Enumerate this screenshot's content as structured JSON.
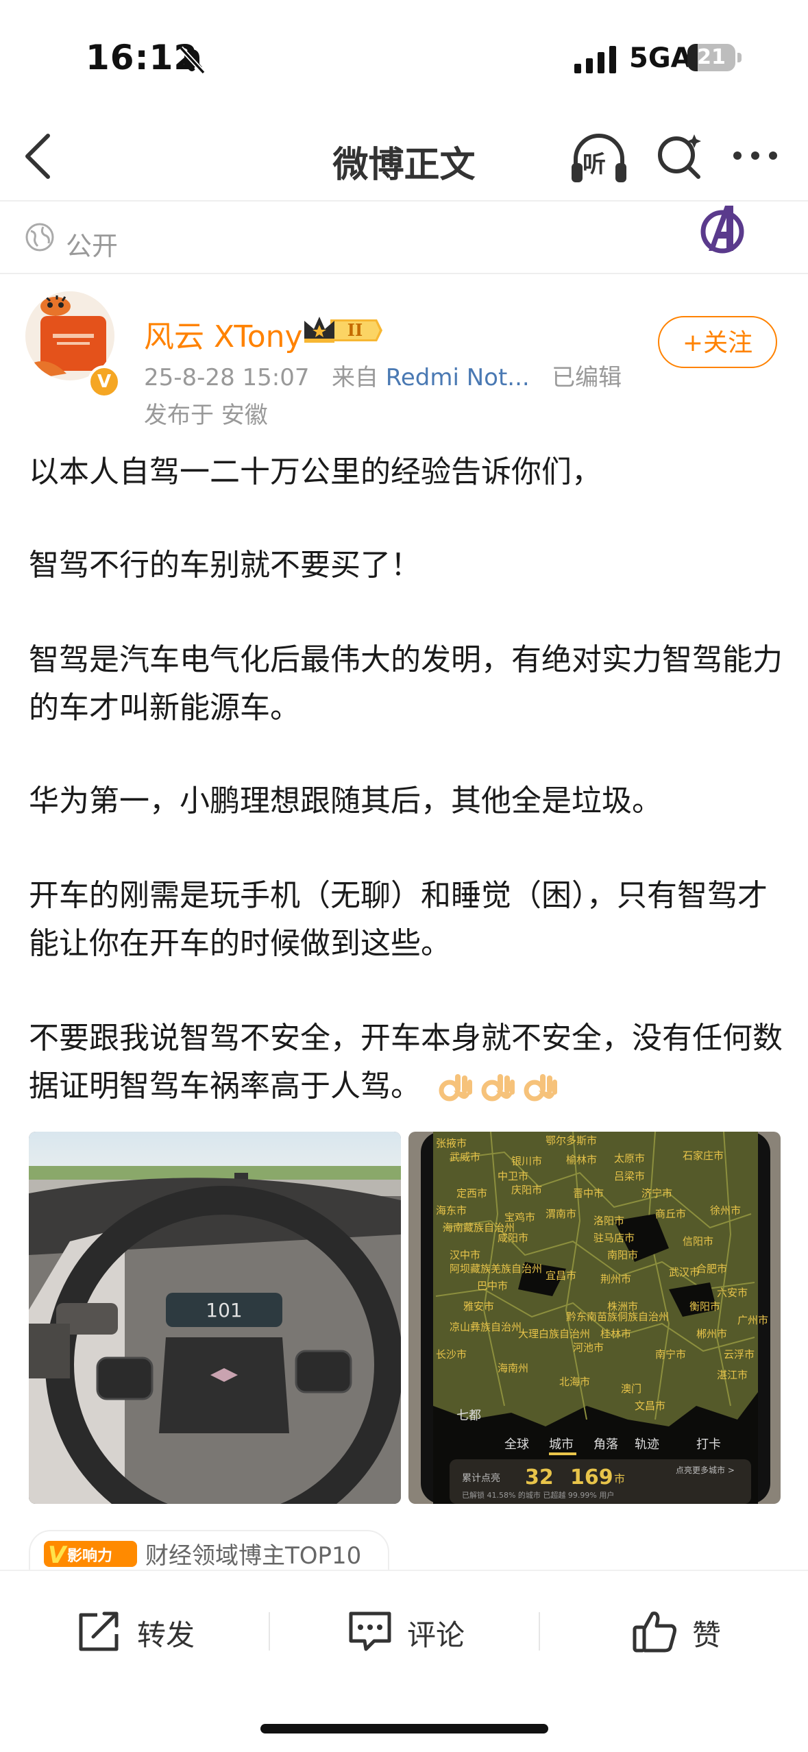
{
  "status_bar": {
    "time": "16:12",
    "network": "5GA",
    "battery": "21",
    "battery_level": 0.21
  },
  "nav": {
    "title": "微博正文",
    "listen_icon_text": "听"
  },
  "visibility": {
    "label": "公开"
  },
  "author": {
    "name": "风云 XTony",
    "level": "II",
    "timestamp": "25-8-28 15:07",
    "source_prefix": "来自",
    "source": "Redmi Not...",
    "edited": "已编辑",
    "location": "发布于 安徽",
    "verified_mark": "V"
  },
  "follow_button": "+关注",
  "post": {
    "paragraphs": [
      "以本人自驾一二十万公里的经验告诉你们，",
      "智驾不行的车别就不要买了！",
      "智驾是汽车电气化后最伟大的发明，有绝对实力智驾能力的车才叫新能源车。",
      "华为第一，小鹏理想跟随其后，其他全是垃圾。",
      "开车的刚需是玩手机（无聊）和睡觉（困），只有智驾才能让你在开车的时候做到这些。",
      "不要跟我说智驾不安全，开车本身就不安全，没有任何数据证明智驾车祸率高于人驾。"
    ],
    "emoji_count": 3
  },
  "images": {
    "photo1": {
      "speed": "101"
    },
    "photo2": {
      "cities": [
        "张掖市",
        "鄂尔多斯市",
        "武威市",
        "银川市",
        "榆林市",
        "太原市",
        "石家庄市",
        "中卫市",
        "吕梁市",
        "定西市",
        "庆阳市",
        "晋中市",
        "济宁市",
        "海东市",
        "海南藏族自治州",
        "宝鸡市",
        "渭南市",
        "洛阳市",
        "商丘市",
        "徐州市",
        "咸阳市",
        "汉中市",
        "驻马店市",
        "信阳市",
        "阿坝藏族羌族自治州",
        "南阳市",
        "合肥市",
        "巴中市",
        "宜昌市",
        "荆州市",
        "武汉市",
        "雅安市",
        "六安市",
        "凉山彝族自治州",
        "黔东南苗族侗族自治州",
        "株洲市",
        "衡阳市",
        "长沙市",
        "大理白族自治州",
        "桂林市",
        "郴州市",
        "海南州",
        "河池市",
        "南宁市",
        "云浮市",
        "北海市",
        "澳门",
        "文昌市",
        "湛江市",
        "广州市"
      ],
      "tabs": [
        "全球",
        "城市",
        "角落",
        "轨迹",
        "打卡"
      ],
      "lit_label": "累计点亮",
      "lit_cities": "32",
      "lit_total": "169",
      "lit_unit": "市",
      "percent_line": "已解锁 41.58% 的城市 已超越 99.99% 用户",
      "more_link": "点亮更多城市 >",
      "side_label": "七都"
    }
  },
  "influence": {
    "badge_v": "V",
    "badge_text": "影响力",
    "text": "财经领域博主TOP10"
  },
  "actions": {
    "repost": "转发",
    "comment": "评论",
    "like": "赞"
  },
  "colors": {
    "accent": "#ff8200",
    "link": "#4a79b3",
    "muted": "#999999",
    "text": "#1a1a1a"
  }
}
